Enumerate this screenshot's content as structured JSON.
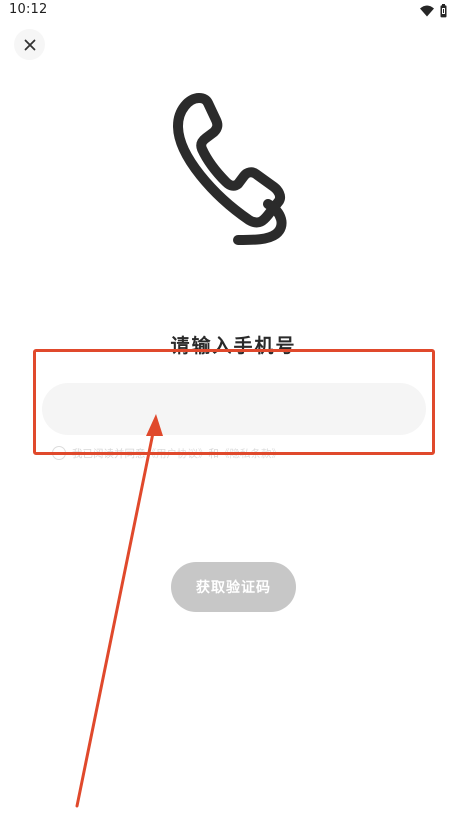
{
  "status_bar": {
    "time": "10:12",
    "icons": [
      "wifi-icon",
      "battery-icon"
    ]
  },
  "close_button": {
    "icon": "close-icon"
  },
  "hero_icon": "phone-icon",
  "title": "请输入手机号",
  "phone_input": {
    "value": "",
    "placeholder": ""
  },
  "agreement": {
    "checked": false,
    "prefix": "我已阅读并同意",
    "user_agreement": "《用户协议》",
    "conjunction": "和",
    "privacy_policy": "《隐私条款》"
  },
  "get_code_button": {
    "label": "获取验证码",
    "enabled": false
  },
  "colors": {
    "background": "#ffffff",
    "input_background": "#f5f5f5",
    "button_disabled": "#c7c7c7",
    "icon_dark": "#2b2b2b",
    "annotation_red": "#e0492c"
  }
}
